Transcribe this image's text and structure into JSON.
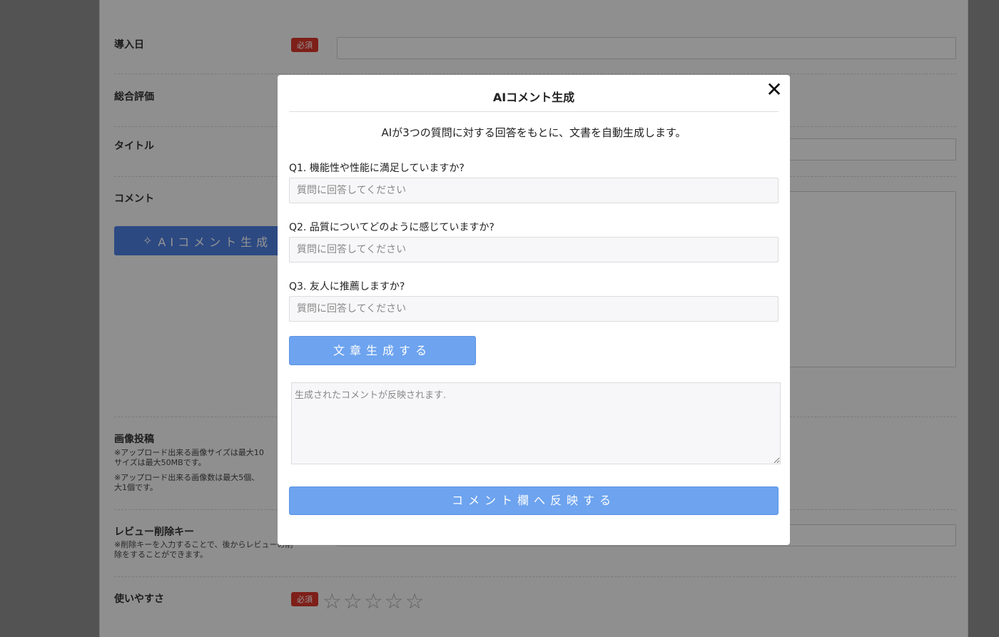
{
  "background": {
    "fields": {
      "intro_date": {
        "label": "導入日",
        "required": "必須"
      },
      "overall_rating": {
        "label": "総合評価"
      },
      "title": {
        "label": "タイトル"
      },
      "comment": {
        "label": "コメント"
      },
      "ai_button": {
        "icon": "sparkle-icon",
        "label": "AIコメント生成"
      },
      "image_upload": {
        "label": "画像投稿",
        "note1_line1": "※アップロード出来る画像サイズは最大10",
        "note1_line2": "サイズは最大50MBです。",
        "note2_line1": "※アップロード出来る画像数は最大5個、",
        "note2_line2": "大1個です。"
      },
      "delete_key": {
        "label": "レビュー削除キー",
        "note_line1": "※削除キーを入力することで、後からレビューの削",
        "note_line2": "除をすることができます。"
      },
      "usability": {
        "label": "使いやすさ",
        "required": "必須",
        "stars": "☆☆☆☆☆",
        "rating": 0,
        "max": 5
      }
    }
  },
  "modal": {
    "title": "AIコメント生成",
    "close_icon": "✕",
    "description": "AIが3つの質問に対する回答をもとに、文書を自動生成します。",
    "questions": [
      {
        "label": "Q1. 機能性や性能に満足していますか?",
        "placeholder": "質問に回答してください",
        "value": ""
      },
      {
        "label": "Q2. 品質についてどのように感じていますか?",
        "placeholder": "質問に回答してください",
        "value": ""
      },
      {
        "label": "Q3. 友人に推薦しますか?",
        "placeholder": "質問に回答してください",
        "value": ""
      }
    ],
    "generate_button": "文章生成する",
    "output_placeholder": "生成されたコメントが反映されます.",
    "reflect_button": "コメント欄へ反映する"
  },
  "colors": {
    "accent": "#6da3ef",
    "required_badge": "#d9362b",
    "overlay": "#8f8f8f"
  }
}
